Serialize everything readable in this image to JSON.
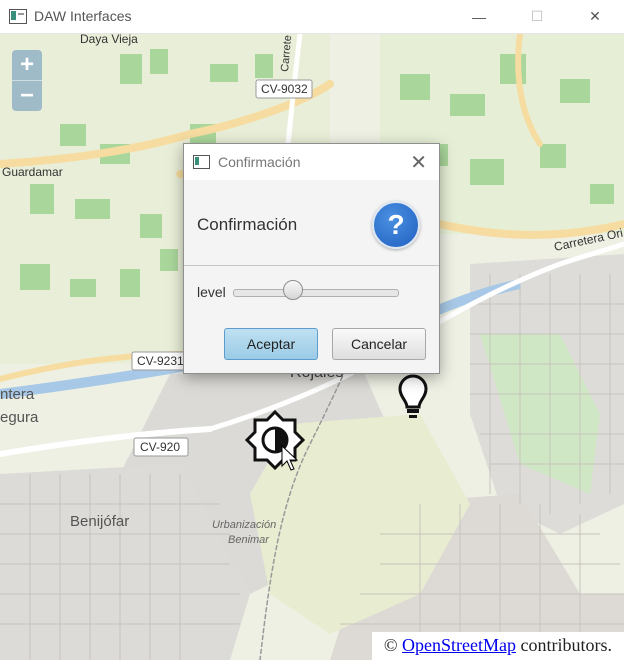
{
  "window": {
    "title": "DAW Interfaces",
    "minimize": "—",
    "maximize": "☐",
    "close": "✕"
  },
  "map": {
    "zoom_in": "+",
    "zoom_out": "−",
    "place_labels": [
      "Daya Vieja",
      "CV-9032",
      "Guardamar",
      "Carretera Ori",
      "CV-9231",
      "CV-920",
      "ntera",
      "egura",
      "Benijófar",
      "Urbanización",
      "Benimar",
      "Rojales",
      "Carrete"
    ],
    "attribution": {
      "prefix": "©",
      "link_text": "OpenStreetMap",
      "suffix": "contributors."
    }
  },
  "dialog": {
    "title": "Confirmación",
    "header_text": "Confirmación",
    "close": "✕",
    "question_icon": "?",
    "slider_label": "level",
    "slider_value": 0.36,
    "accept_label": "Aceptar",
    "cancel_label": "Cancelar"
  }
}
